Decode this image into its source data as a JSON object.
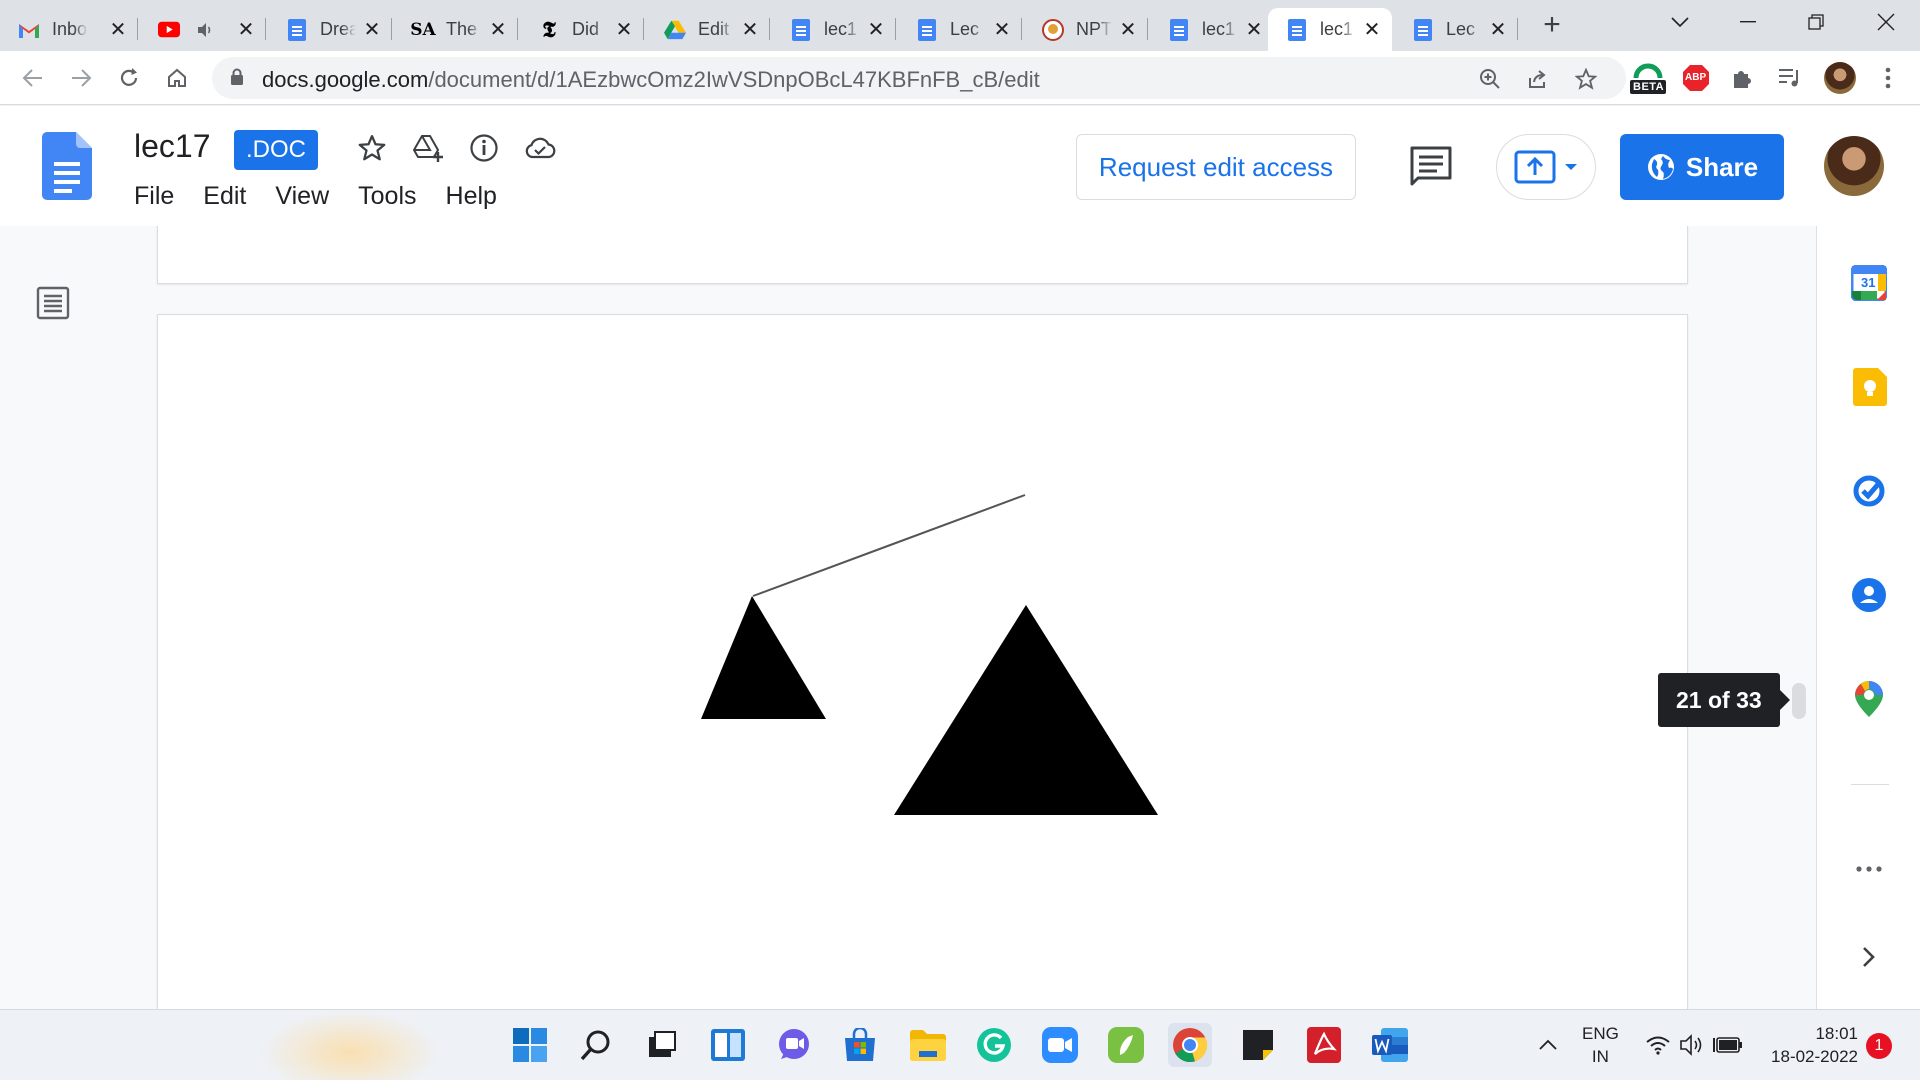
{
  "browser": {
    "tabs": [
      {
        "title": "Inbox",
        "favicon": "gmail-icon"
      },
      {
        "title": "",
        "favicon": "youtube-icon",
        "audio": true
      },
      {
        "title": "Dream",
        "favicon": "docs-icon"
      },
      {
        "title": "The",
        "favicon": "sa-icon"
      },
      {
        "title": "Did",
        "favicon": "nyt-icon"
      },
      {
        "title": "Edit",
        "favicon": "drive-icon"
      },
      {
        "title": "lec1",
        "favicon": "docs-icon"
      },
      {
        "title": "Lec",
        "favicon": "docs-icon"
      },
      {
        "title": "NPT",
        "favicon": "nptel-icon"
      },
      {
        "title": "lec1",
        "favicon": "docs-icon"
      },
      {
        "title": "lec1",
        "favicon": "docs-icon",
        "active": true
      },
      {
        "title": "Lec",
        "favicon": "docs-icon"
      }
    ],
    "url_host": "docs.google.com",
    "url_path": "/document/d/1AEzbwcOmz2IwVSDnpOBcL47KBFnFB_cB/edit",
    "extensions": {
      "beta_label": "BETA",
      "abp_label": "ABP"
    }
  },
  "docs": {
    "title": "lec17",
    "badge": ".DOC",
    "menu": [
      "File",
      "Edit",
      "View",
      "Tools",
      "Help"
    ],
    "request_edit_label": "Request edit access",
    "share_label": "Share",
    "page_indicator": "21 of 33",
    "side_panel": {
      "calendar_day": "31"
    }
  },
  "taskbar": {
    "lang_line1": "ENG",
    "lang_line2": "IN",
    "time": "18:01",
    "date": "18-02-2022",
    "notifications": "1"
  },
  "colors": {
    "accent": "#1a73e8",
    "tab_strip": "#dee1e6",
    "docs_blue": "#4285f4"
  }
}
